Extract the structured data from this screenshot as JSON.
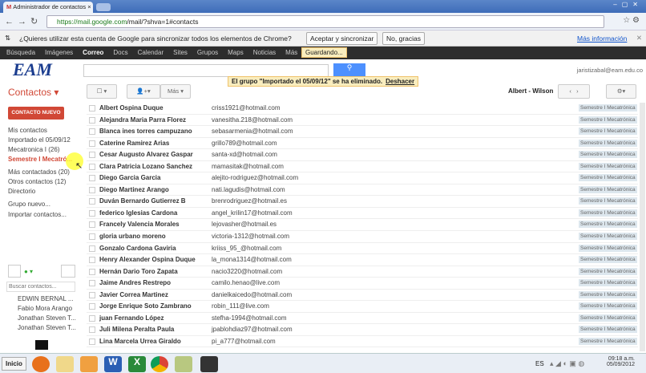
{
  "browser": {
    "tab_title": "Administrador de contactos",
    "url_host": "https://mail.google.com",
    "url_path": "/mail/?shva=1#contacts"
  },
  "infobar": {
    "message": "¿Quieres utilizar esta cuenta de Google para sincronizar todos los elementos de Chrome?",
    "accept": "Aceptar y sincronizar",
    "decline": "No, gracias",
    "more": "Más información"
  },
  "topnav": [
    "Búsqueda",
    "Imágenes",
    "Correo",
    "Docs",
    "Calendar",
    "Sites",
    "Grupos",
    "Maps",
    "Noticias",
    "Más"
  ],
  "saving": "Guardando...",
  "logo": "EAM",
  "user": "jaristizabal@eam.edu.co",
  "notice": {
    "text": "El grupo \"Importado el 05/09/12\" se ha eliminado.",
    "undo": "Deshacer"
  },
  "toolbar": {
    "title": "Contactos",
    "more": "Más",
    "range": "Albert - Wilson"
  },
  "sidebar": {
    "new_contact": "CONTACTO NUEVO",
    "items": [
      "Mis contactos",
      "Importado el 05/09/12",
      "Mecatronica I (26)",
      "Semestre I Mecatró...",
      "Más contactados (20)",
      "Otros contactos (12)",
      "Directorio",
      "Grupo nuevo...",
      "Importar contactos..."
    ],
    "search_placeholder": "Buscar contactos...",
    "chat": [
      "EDWIN BERNAL ...",
      "Fabio Mora Arango",
      "Jonathan Steven T...",
      "Jonathan Steven T..."
    ]
  },
  "contacts": [
    {
      "name": "Albert Ospina Duque",
      "email": "criss1921@hotmail.com"
    },
    {
      "name": "Alejandra Maria Parra Florez",
      "email": "vanesitha.218@hotmail.com"
    },
    {
      "name": "Blanca ines torres campuzano",
      "email": "sebasarmenia@hotmail.com"
    },
    {
      "name": "Caterine Ramirez Arias",
      "email": "grillo789@hotmail.com"
    },
    {
      "name": "Cesar Augusto Alvarez Gaspar",
      "email": "santa-xd@hotmail.com"
    },
    {
      "name": "Clara Patricia Lozano Sanchez",
      "email": "mamasitak@hotmail.com"
    },
    {
      "name": "Diego Garcia Garcia",
      "email": "alejito-rodriguez@hotmail.com"
    },
    {
      "name": "Diego Martinez Arango",
      "email": "nati.lagudis@hotmail.com"
    },
    {
      "name": "Duván Bernardo Gutierrez B",
      "email": "brenrodriguez@hotmail.es"
    },
    {
      "name": "federico Iglesias Cardona",
      "email": "angel_krilin17@hotmail.com"
    },
    {
      "name": "Francely Valencia Morales",
      "email": "lejovasher@hotmail.es"
    },
    {
      "name": "gloria urbano moreno",
      "email": "victoria-1312@hotmail.com"
    },
    {
      "name": "Gonzalo Cardona Gaviria",
      "email": "kriiss_95_@hotmail.com"
    },
    {
      "name": "Henry Alexander Ospina Duque",
      "email": "la_mona1314@hotmail.com"
    },
    {
      "name": "Hernán Dario Toro Zapata",
      "email": "nacio3220@hotmail.com"
    },
    {
      "name": "Jaime Andres Restrepo",
      "email": "camilo.henao@live.com"
    },
    {
      "name": "Javier Correa Martinez",
      "email": "danielkaicedo@hotmail.com"
    },
    {
      "name": "Jorge Enrique Soto Zambrano",
      "email": "robin_111@live.com"
    },
    {
      "name": "juan Fernando López",
      "email": "stefha-1994@hotmail.com"
    },
    {
      "name": "Juli Milena Peralta Paula",
      "email": "jpablohdiaz97@hotmail.com"
    },
    {
      "name": "Lina Marcela Urrea Giraldo",
      "email": "pi_a777@hotmail.com"
    }
  ],
  "tag": "Semestre I Mecatrónica",
  "taskbar": {
    "start": "Inicio",
    "lang": "ES",
    "time": "09:18 a.m.",
    "date": "05/09/2012"
  },
  "colors": {
    "accent": "#d14836",
    "search": "#4d90fe",
    "notice": "#f9edbe"
  }
}
